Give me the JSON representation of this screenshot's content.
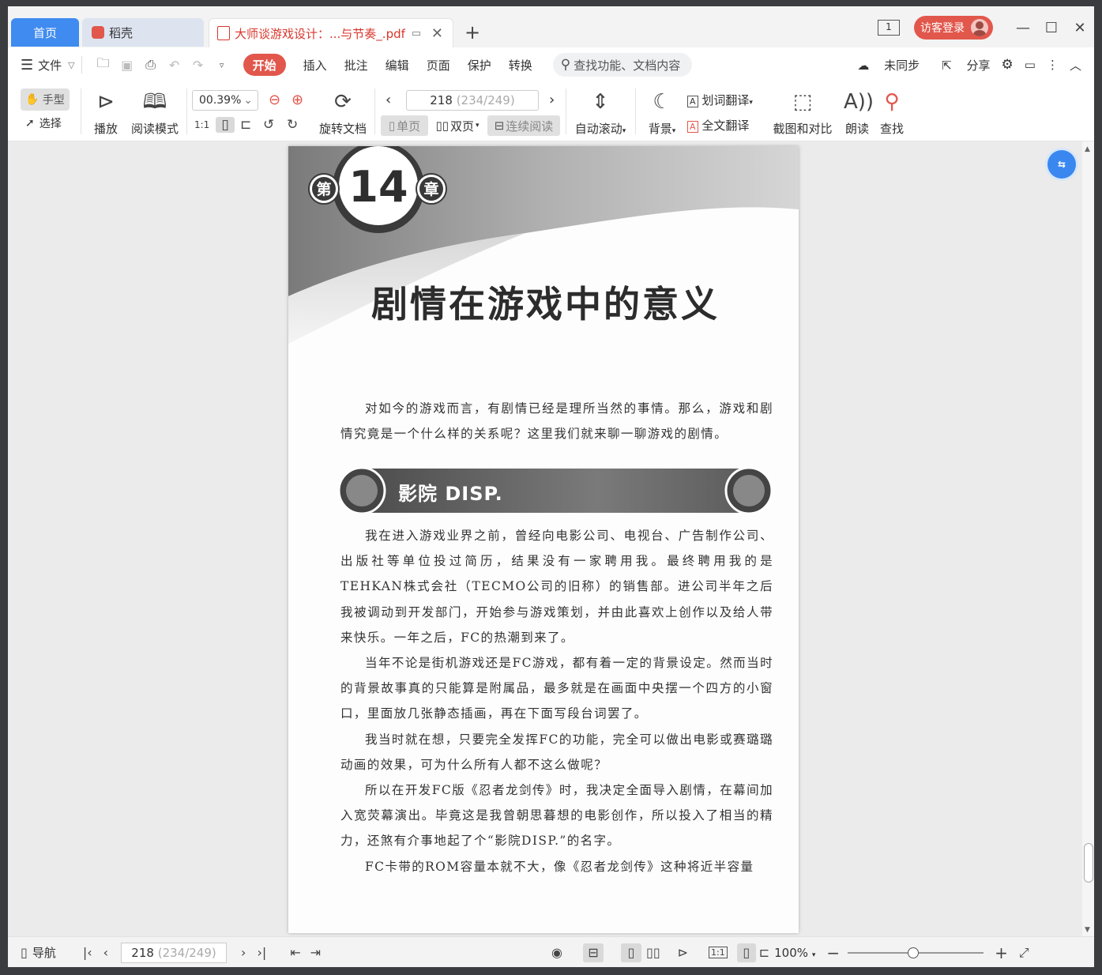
{
  "tabs": {
    "home": "首页",
    "daoke": "稻壳",
    "document": "大师谈游戏设计：...与节奏_.pdf"
  },
  "window": {
    "page_indicator": "1",
    "login": "访客登录"
  },
  "menubar": {
    "file": "文件",
    "tabs": [
      "开始",
      "插入",
      "批注",
      "编辑",
      "页面",
      "保护",
      "转换"
    ],
    "search_placeholder": "查找功能、文档内容",
    "sync": "未同步",
    "share": "分享"
  },
  "toolbar": {
    "hand": "手型",
    "select": "选择",
    "play": "播放",
    "read_mode": "阅读模式",
    "zoom": "00.39%",
    "rotate": "旋转文档",
    "page_current": "218",
    "page_total": "(234/249)",
    "single": "单页",
    "double": "双页",
    "continuous": "连续阅读",
    "autoscroll": "自动滚动",
    "background": "背景",
    "word_translate": "划词翻译",
    "full_translate": "全文翻译",
    "screenshot": "截图和对比",
    "read_aloud": "朗读",
    "find": "查找"
  },
  "page": {
    "chapter_prefix": "第",
    "chapter_number": "14",
    "chapter_suffix": "章",
    "title": "剧情在游戏中的意义",
    "intro": "对如今的游戏而言，有剧情已经是理所当然的事情。那么，游戏和剧情究竟是一个什么样的关系呢？这里我们就来聊一聊游戏的剧情。",
    "section_title": "影院 DISP.",
    "paragraphs": [
      "我在进入游戏业界之前，曾经向电影公司、电视台、广告制作公司、出版社等单位投过简历，结果没有一家聘用我。最终聘用我的是TEHKAN株式会社（TECMO公司的旧称）的销售部。进公司半年之后我被调动到开发部门，开始参与游戏策划，并由此喜欢上创作以及给人带来快乐。一年之后，FC的热潮到来了。",
      "当年不论是街机游戏还是FC游戏，都有着一定的背景设定。然而当时的背景故事真的只能算是附属品，最多就是在画面中央摆一个四方的小窗口，里面放几张静态插画，再在下面写段台词罢了。",
      "我当时就在想，只要完全发挥FC的功能，完全可以做出电影或赛璐璐动画的效果，可为什么所有人都不这么做呢？",
      "所以在开发FC版《忍者龙剑传》时，我决定全面导入剧情，在幕间加入宽荧幕演出。毕竟这是我曾朝思暮想的电影创作，所以投入了相当的精力，还煞有介事地起了个“影院DISP.”的名字。",
      "FC卡带的ROM容量本就不大，像《忍者龙剑传》这种将近半容量"
    ]
  },
  "status": {
    "nav": "导航",
    "page_current": "218",
    "page_total": "(234/249)",
    "zoom": "100%"
  },
  "colors": {
    "accent_red": "#e2574c",
    "home_tab_blue": "#3f8bf0",
    "float_button_blue": "#3a87f0"
  }
}
